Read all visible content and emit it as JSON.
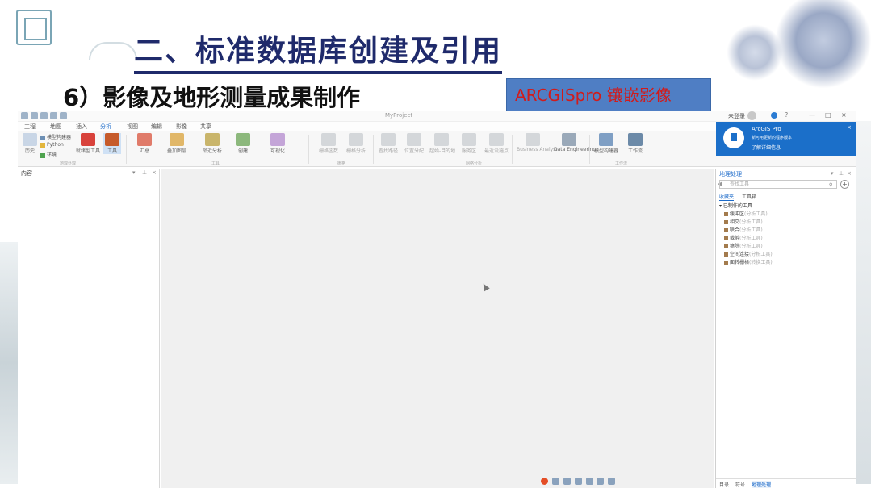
{
  "slide": {
    "title": "二、标准数据库创建及引用",
    "subtitle": "6）影像及地形测量成果制作",
    "tag": "ARCGISpro 镶嵌影像"
  },
  "app": {
    "project_name": "MyProject",
    "user_name": "未登录",
    "tabs": [
      {
        "label": "工程"
      },
      {
        "label": "地图"
      },
      {
        "label": "插入"
      },
      {
        "label": "分析",
        "active": true
      },
      {
        "label": "视图"
      },
      {
        "label": "编辑"
      },
      {
        "label": "影像"
      },
      {
        "label": "共享"
      }
    ],
    "ribbon": {
      "history_label": "历史",
      "model_builder_label": "模型构建器",
      "python_label": "Python",
      "env_label": "环境",
      "ready_tools_label": "就绪型工具",
      "tools_label": "工具",
      "group_geoprocessing": "地理处理",
      "btn_summarize": "汇总",
      "btn_overlay": "叠加图层",
      "btn_proximity": "邻近分析",
      "btn_create": "创建",
      "btn_visualize": "可视化",
      "group_tools": "工具",
      "btn_raster_fn": "栅格函数",
      "btn_raster_analysis": "栅格分析",
      "group_raster": "栅格",
      "btn_find_path": "查找路径",
      "btn_location_alloc": "位置分配",
      "btn_od": "起始-目的地",
      "btn_service_area": "服务区",
      "btn_closest_facility": "最近设施点",
      "group_network": "网络分析",
      "btn_business_analyst": "Business Analyst",
      "btn_data_engineering": "Data Engineering",
      "btn_model_builder_2": "模型构建器",
      "btn_workflows": "工作流",
      "group_workflows": "工作流"
    },
    "notification": {
      "title": "ArcGIS Pro",
      "body": "新可用更新的程序版本",
      "link": "了解详细信息"
    },
    "contents_pane": {
      "title": "内容",
      "pin": "▾",
      "auto_hide": "⊥",
      "close": "×"
    },
    "geoprocessing_pane": {
      "title": "地理处理",
      "search_placeholder": "查找工具",
      "subtabs": [
        {
          "label": "收藏夹",
          "active": true
        },
        {
          "label": "工具箱"
        }
      ],
      "tree_root": "已制作的工具",
      "tools": [
        {
          "label": "缓冲区",
          "hint": "(分析工具)"
        },
        {
          "label": "相交",
          "hint": "(分析工具)"
        },
        {
          "label": "联合",
          "hint": "(分析工具)"
        },
        {
          "label": "裁剪",
          "hint": "(分析工具)"
        },
        {
          "label": "擦除",
          "hint": "(分析工具)"
        },
        {
          "label": "空间连接",
          "hint": "(分析工具)"
        },
        {
          "label": "面转栅格",
          "hint": "(转换工具)"
        }
      ],
      "bottom_tabs": [
        {
          "label": "目录"
        },
        {
          "label": "符号"
        },
        {
          "label": "地理处理",
          "active": true
        }
      ]
    }
  }
}
